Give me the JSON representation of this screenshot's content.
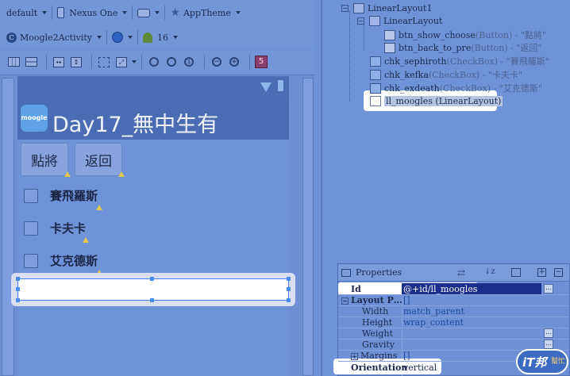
{
  "toolbar1": {
    "config": "default",
    "device": "Nexus One",
    "theme": "AppTheme"
  },
  "toolbar2": {
    "activity": "Moogle2Activity",
    "api_level": "16"
  },
  "toolbar3": {
    "warning_count": "5"
  },
  "app": {
    "title": "Day17_無中生有",
    "logo_text": "moogle"
  },
  "buttons": {
    "show_choose": "點將",
    "back_to_pre": "返回"
  },
  "checkboxes": [
    {
      "label": "賽飛羅斯"
    },
    {
      "label": "卡夫卡"
    },
    {
      "label": "艾克德斯"
    }
  ],
  "outline": [
    {
      "text": "LinearLayout1"
    },
    {
      "text": "LinearLayout"
    },
    {
      "text": "btn_show_choose",
      "type": " (Button) - \"點將\""
    },
    {
      "text": "btn_back_to_pre",
      "type": " (Button) - \"返回\""
    },
    {
      "text": "chk_sephiroth",
      "type": " (CheckBox) - \"賽飛羅斯\""
    },
    {
      "text": "chk_kefka",
      "type": " (CheckBox) - \"卡夫卡\""
    },
    {
      "text": "chk_exdeath",
      "type": " (CheckBox) - \"艾克德斯\""
    },
    {
      "text": "ll_moogles (LinearLayout)"
    }
  ],
  "properties": {
    "title": "Properties",
    "rows": [
      {
        "name": "Id",
        "value": "@+id/ll_moogles"
      },
      {
        "name": "Layout P…",
        "value": "[]"
      },
      {
        "name": "Width",
        "value": "match_parent"
      },
      {
        "name": "Height",
        "value": "wrap_content"
      },
      {
        "name": "Weight",
        "value": ""
      },
      {
        "name": "Gravity",
        "value": ""
      },
      {
        "name": "Margins",
        "value": "[]"
      },
      {
        "name": "Orientation",
        "value": "vertical"
      }
    ]
  },
  "watermark": {
    "brand": "iT邦",
    "sub": "幫忙"
  },
  "colors": {
    "accent": "#4a8cf4",
    "selected_id": "#1a2f8c",
    "warning": "#e0c84b"
  }
}
